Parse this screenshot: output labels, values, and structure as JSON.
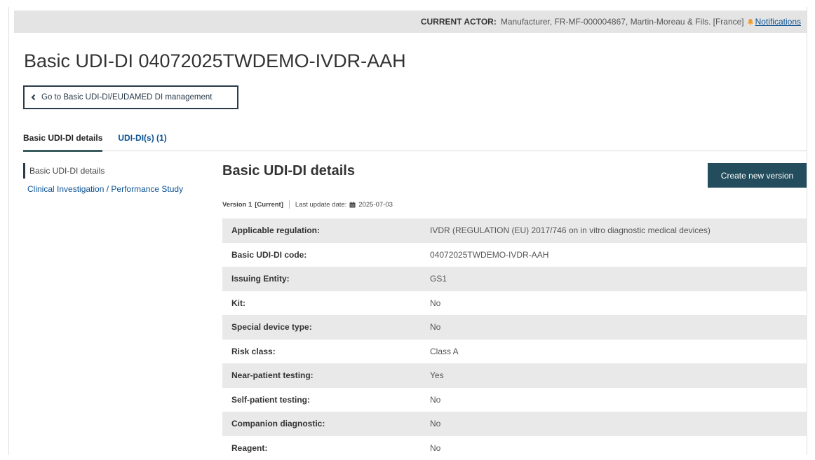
{
  "actor_bar": {
    "label": "CURRENT ACTOR:",
    "value": "Manufacturer, FR-MF-000004867, Martin-Moreau & Fils. [France]",
    "notifications": "Notifications",
    "bell_icon": "bell-icon"
  },
  "page": {
    "title": "Basic UDI-DI 04072025TWDEMO-IVDR-AAH",
    "back_button": "Go to Basic UDI-DI/EUDAMED DI management"
  },
  "tabs": [
    {
      "label": "Basic UDI-DI details",
      "active": true
    },
    {
      "label": "UDI-DI(s) (1)",
      "active": false
    }
  ],
  "side_nav": [
    {
      "label": "Basic UDI-DI details",
      "active": true
    },
    {
      "label": "Clinical Investigation / Performance Study",
      "active": false
    }
  ],
  "section": {
    "title": "Basic UDI-DI details",
    "create_button": "Create new version",
    "version": "Version 1",
    "current": "[Current]",
    "last_update_label": "Last update date:",
    "last_update_value": "2025-07-03"
  },
  "details": [
    {
      "label": "Applicable regulation:",
      "value": "IVDR (REGULATION (EU) 2017/746 on in vitro diagnostic medical devices)"
    },
    {
      "label": "Basic UDI-DI code:",
      "value": "04072025TWDEMO-IVDR-AAH"
    },
    {
      "label": "Issuing Entity:",
      "value": "GS1"
    },
    {
      "label": "Kit:",
      "value": "No"
    },
    {
      "label": "Special device type:",
      "value": "No"
    },
    {
      "label": "Risk class:",
      "value": "Class A"
    },
    {
      "label": "Near-patient testing:",
      "value": "Yes"
    },
    {
      "label": "Self-patient testing:",
      "value": "No"
    },
    {
      "label": "Companion diagnostic:",
      "value": "No"
    },
    {
      "label": "Reagent:",
      "value": "No"
    }
  ],
  "colors": {
    "primary_button": "#234d5c",
    "link": "#0b5394",
    "bell": "#f0a030"
  }
}
